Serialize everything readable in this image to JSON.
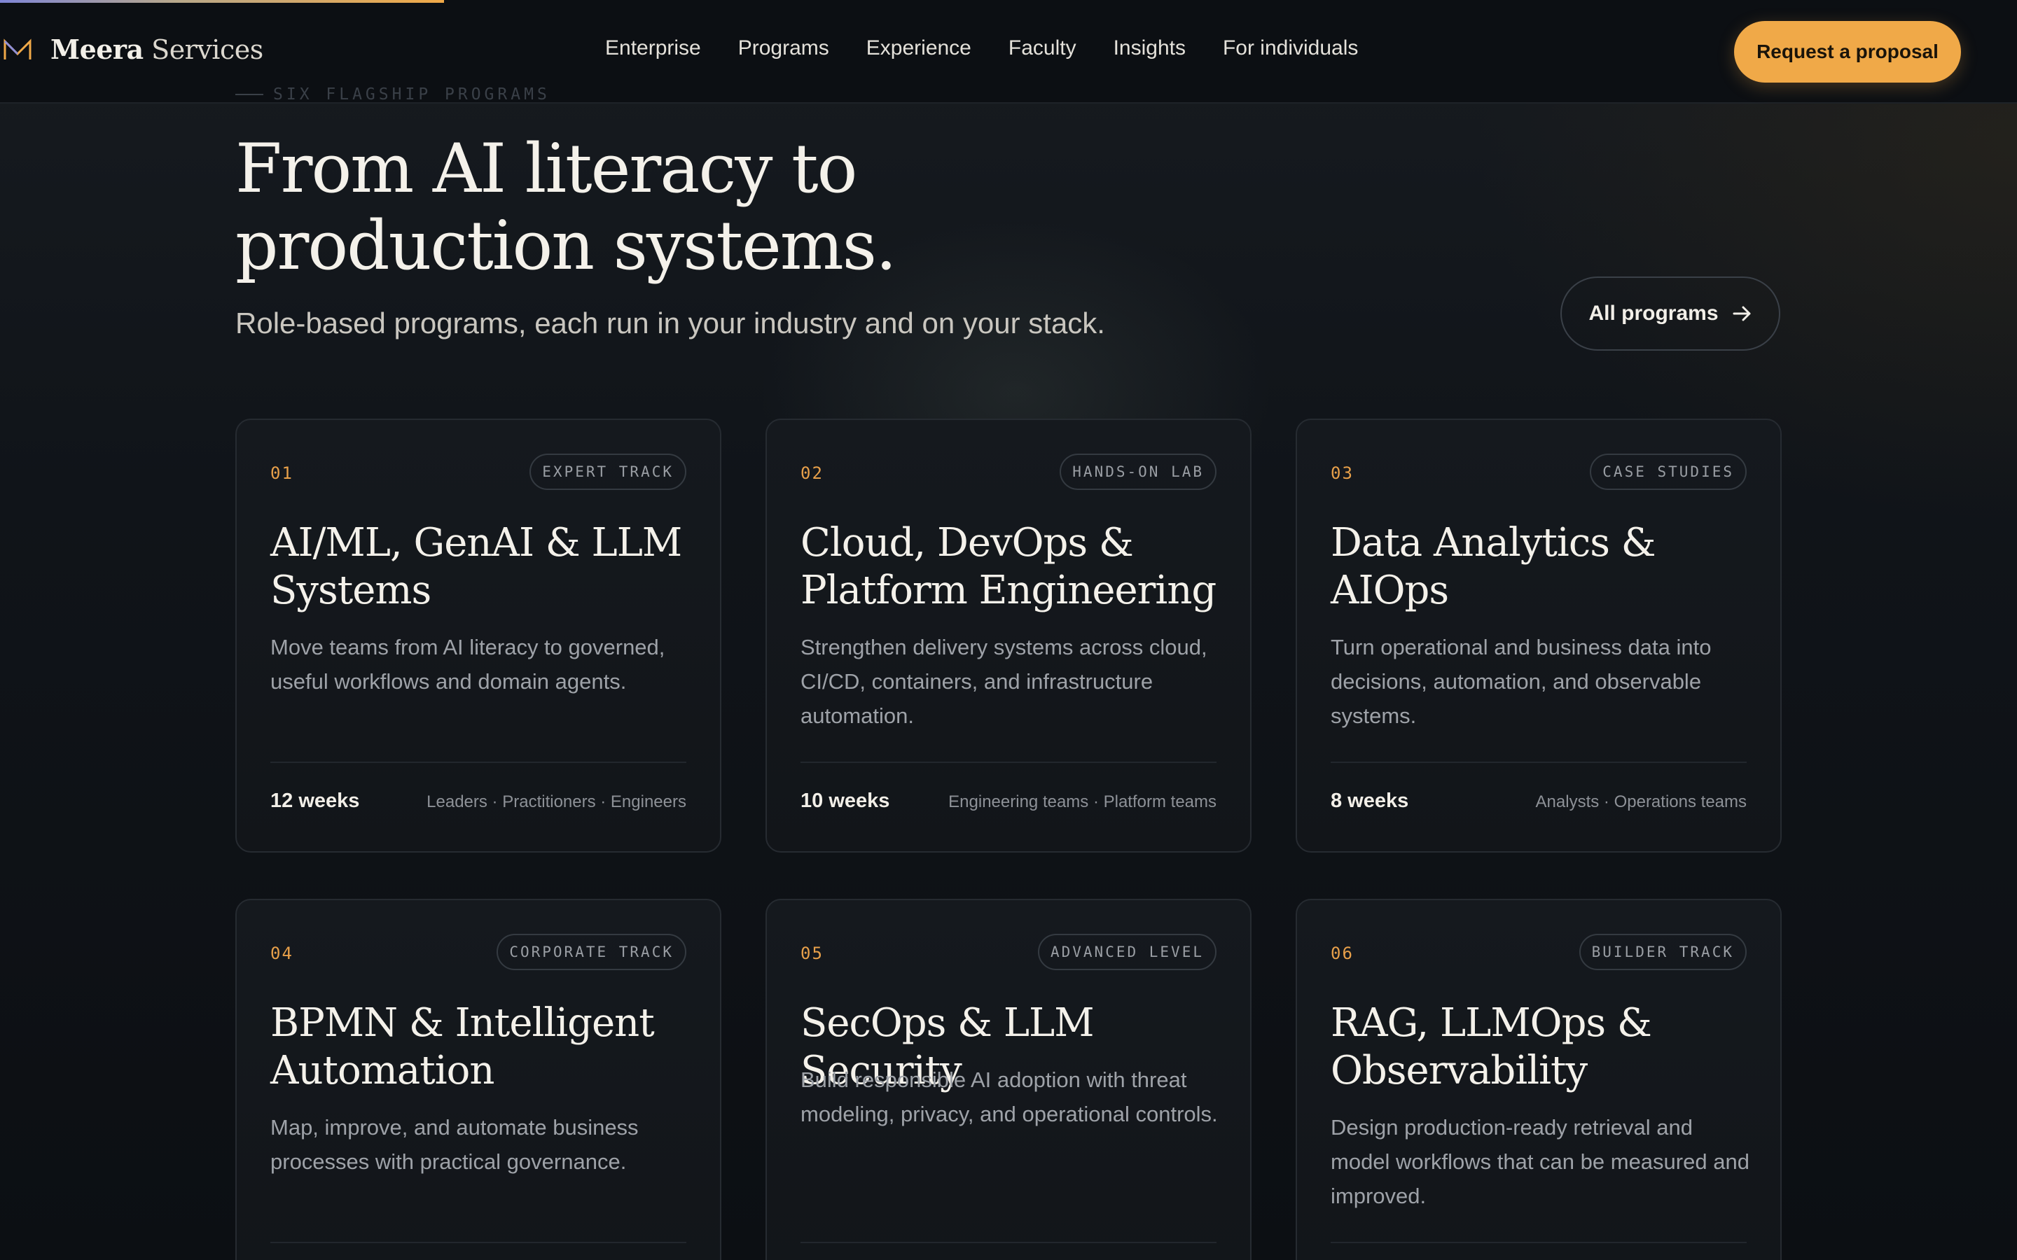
{
  "progress": {
    "percent": 22
  },
  "brand": {
    "name_bold": "Meera",
    "name_light": "Services",
    "accent": "#f0a948"
  },
  "nav": {
    "items": [
      "Enterprise",
      "Programs",
      "Experience",
      "Faculty",
      "Insights",
      "For individuals"
    ],
    "cta": "Request a proposal"
  },
  "section": {
    "eyebrow": "SIX FLAGSHIP PROGRAMS",
    "headline_line1": "From AI literacy to",
    "headline_line2": "production systems.",
    "subhead": "Role-based programs, each run in your industry and on your stack.",
    "all_programs": "All programs",
    "all_programs_icon": "arrow-right-icon"
  },
  "cards": [
    {
      "num": "01",
      "tag": "EXPERT TRACK",
      "title_1": "AI/ML, GenAI & LLM",
      "title_2": "Systems",
      "desc": "Move teams from AI literacy to governed, useful workflows and domain agents.",
      "weeks": "12 weeks",
      "audience": "Leaders · Practitioners · Engineers"
    },
    {
      "num": "02",
      "tag": "HANDS-ON LAB",
      "title_1": "Cloud, DevOps &",
      "title_2": "Platform Engineering",
      "desc": "Strengthen delivery systems across cloud, CI/CD, containers, and infrastructure automation.",
      "weeks": "10 weeks",
      "audience": "Engineering teams · Platform teams"
    },
    {
      "num": "03",
      "tag": "CASE STUDIES",
      "title_1": "Data Analytics &",
      "title_2": "AIOps",
      "desc": "Turn operational and business data into decisions, automation, and observable systems.",
      "weeks": "8 weeks",
      "audience": "Analysts · Operations teams"
    },
    {
      "num": "04",
      "tag": "CORPORATE TRACK",
      "title_1": "BPMN & Intelligent",
      "title_2": "Automation",
      "desc": "Map, improve, and automate business processes with practical governance."
    },
    {
      "num": "05",
      "tag": "ADVANCED LEVEL",
      "title_1": "SecOps & LLM Security",
      "title_2": "",
      "desc": "Build responsible AI adoption with threat modeling, privacy, and operational controls."
    },
    {
      "num": "06",
      "tag": "BUILDER TRACK",
      "title_1": "RAG, LLMOps &",
      "title_2": "Observability",
      "desc": "Design production-ready retrieval and model workflows that can be measured and improved."
    }
  ]
}
